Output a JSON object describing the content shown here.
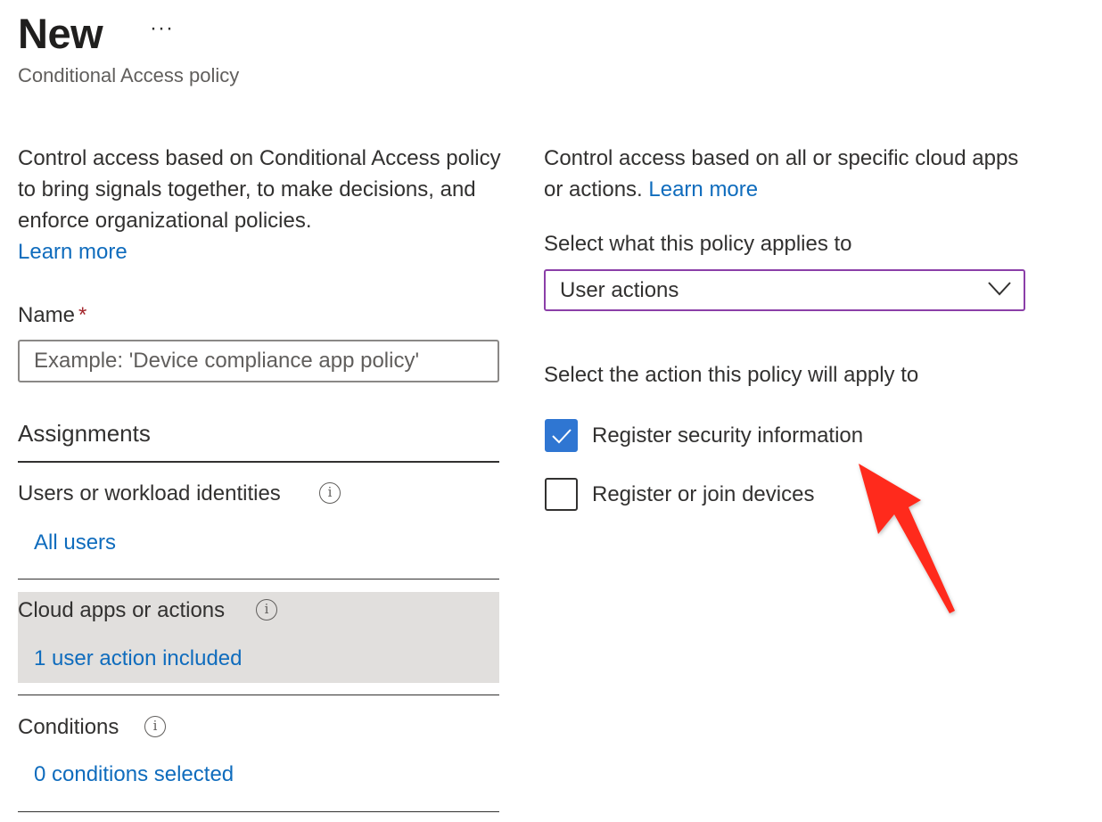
{
  "header": {
    "title": "New",
    "more_label": "···",
    "subtitle": "Conditional Access policy"
  },
  "left": {
    "description": "Control access based on Conditional Access policy to bring signals together, to make decisions, and enforce organizational policies.",
    "learn_more": "Learn more",
    "name_label": "Name",
    "required_mark": "*",
    "name_placeholder": "Example: 'Device compliance app policy'",
    "name_value": "",
    "assignments_heading": "Assignments",
    "sections": [
      {
        "label": "Users or workload identities",
        "value": "All users",
        "selected": false
      },
      {
        "label": "Cloud apps or actions",
        "value": "1 user action included",
        "selected": true
      },
      {
        "label": "Conditions",
        "value": "0 conditions selected",
        "selected": false
      }
    ]
  },
  "right": {
    "description": "Control access based on all or specific cloud apps or actions.",
    "learn_more": "Learn more",
    "applies_label": "Select what this policy applies to",
    "applies_selected": "User actions",
    "action_label": "Select the action this policy will apply to",
    "actions": [
      {
        "label": "Register security information",
        "checked": true
      },
      {
        "label": "Register or join devices",
        "checked": false
      }
    ]
  },
  "annotation": {
    "arrow_color": "#ff2a1a"
  },
  "colors": {
    "link": "#0f6cbd",
    "checkbox_checked": "#2f76d2",
    "dropdown_border": "#8b3fa8",
    "selected_row_bg": "#e1dfdd",
    "required": "#a4262c"
  }
}
